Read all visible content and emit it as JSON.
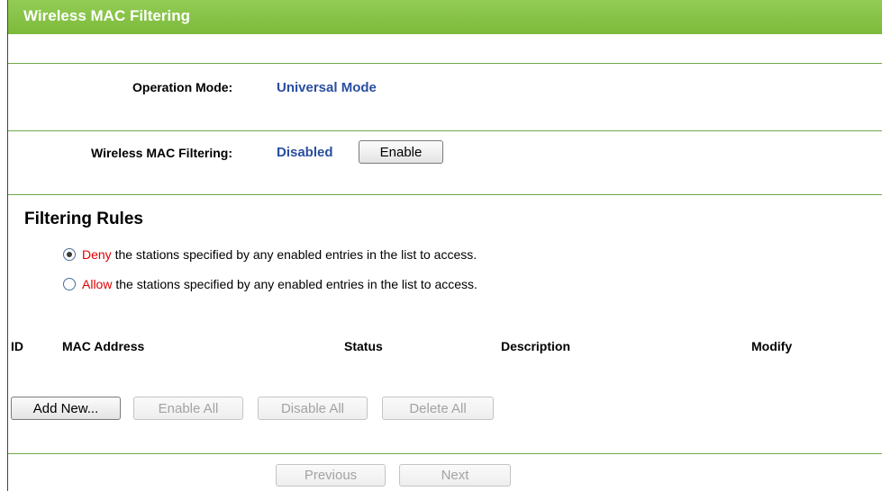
{
  "header": {
    "title": "Wireless MAC Filtering"
  },
  "operation_mode": {
    "label": "Operation Mode:",
    "value": "Universal Mode"
  },
  "mac_filtering": {
    "label": "Wireless MAC Filtering:",
    "status": "Disabled",
    "enable_button": "Enable"
  },
  "filtering_rules": {
    "title": "Filtering Rules",
    "options": [
      {
        "keyword": "Deny",
        "text": " the stations specified by any enabled entries in the list to access.",
        "checked": true
      },
      {
        "keyword": "Allow",
        "text": " the stations specified by any enabled entries in the list to access.",
        "checked": false
      }
    ]
  },
  "table": {
    "columns": [
      "ID",
      "MAC Address",
      "Status",
      "Description",
      "Modify"
    ],
    "rows": []
  },
  "actions": {
    "add_new": "Add New...",
    "enable_all": "Enable All",
    "disable_all": "Disable All",
    "delete_all": "Delete All"
  },
  "pagination": {
    "previous": "Previous",
    "next": "Next"
  },
  "colors": {
    "header_green": "#7cba3b",
    "value_blue": "#2a4ea0",
    "keyword_red": "#e00000"
  }
}
